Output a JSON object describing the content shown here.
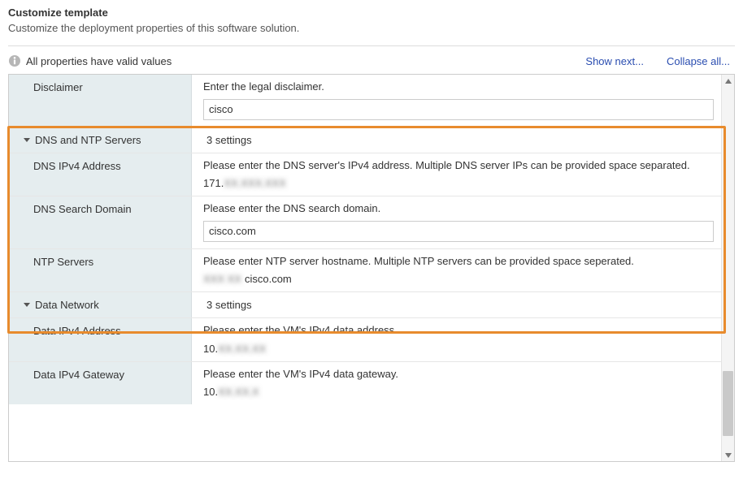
{
  "header": {
    "title": "Customize template",
    "subtitle": "Customize the deployment properties of this software solution."
  },
  "status": {
    "message": "All properties have valid values",
    "show_next": "Show next...",
    "collapse_all": "Collapse all..."
  },
  "sections": {
    "disclaimer": {
      "label": "Disclaimer",
      "desc": "Enter the legal disclaimer.",
      "value": "cisco"
    },
    "dns_ntp": {
      "label": "DNS and NTP Servers",
      "count": "3 settings",
      "dns_ipv4": {
        "label": "DNS IPv4 Address",
        "desc": "Please enter the DNS server's IPv4 address. Multiple DNS server IPs can be provided space separated.",
        "value_prefix": "171.",
        "value_hidden": "XX.XXX.XXX"
      },
      "dns_domain": {
        "label": "DNS Search Domain",
        "desc": "Please enter the DNS search domain.",
        "value": "cisco.com"
      },
      "ntp": {
        "label": "NTP Servers",
        "desc": "Please enter NTP server hostname. Multiple NTP servers can be provided space seperated.",
        "value_hidden": "XXX XX",
        "value_suffix": "cisco.com"
      }
    },
    "data_net": {
      "label": "Data Network",
      "count": "3 settings",
      "data_ipv4": {
        "label": "Data IPv4 Address",
        "desc": "Please enter the VM's IPv4 data address.",
        "value_prefix": "10.",
        "value_hidden": "XX.XX.XX"
      },
      "data_gw": {
        "label": "Data IPv4 Gateway",
        "desc": "Please enter the VM's IPv4 data gateway.",
        "value_prefix": "10.",
        "value_hidden": "XX.XX.X"
      }
    }
  }
}
